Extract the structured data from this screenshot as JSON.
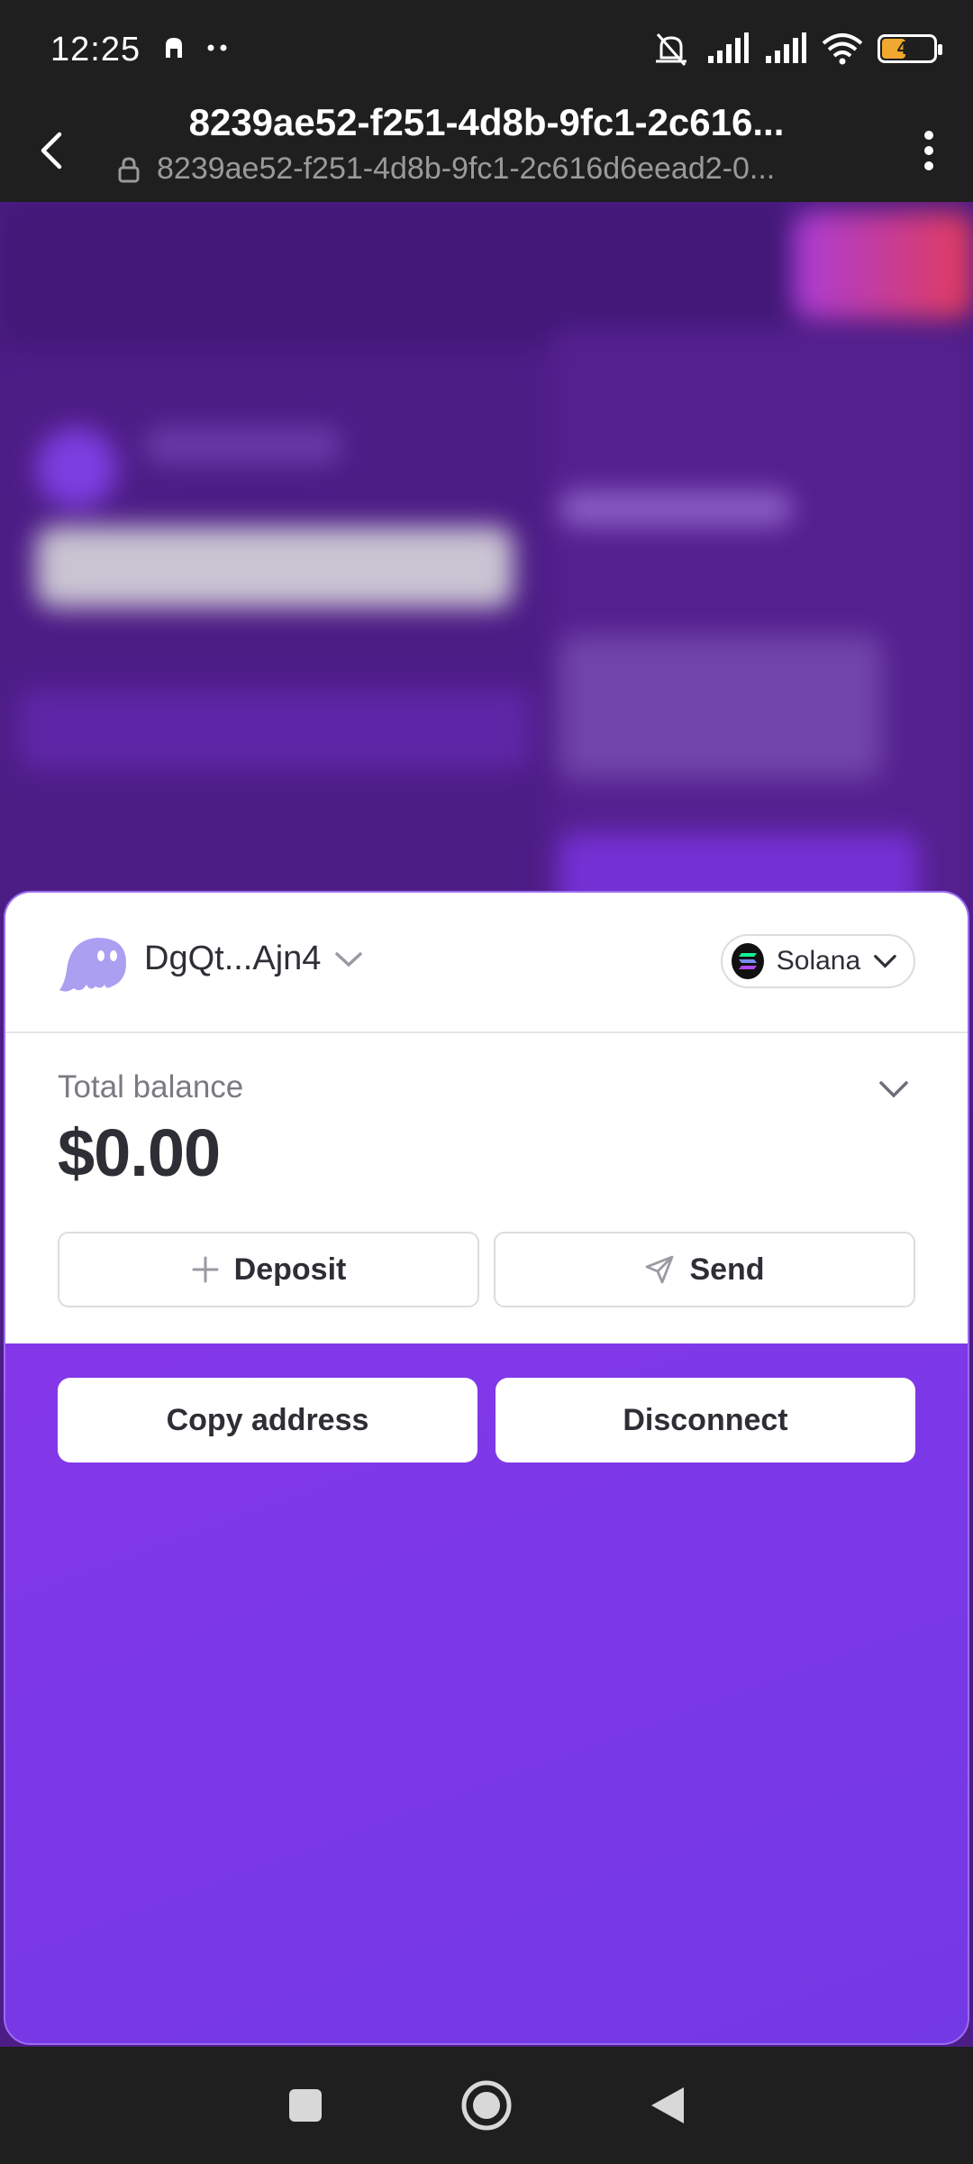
{
  "status_bar": {
    "time": "12:25",
    "battery_level": "43",
    "icons": [
      "notification-icon",
      "more-dots-icon",
      "silent-icon",
      "signal-icon",
      "signal-icon",
      "wifi-icon",
      "battery-icon"
    ]
  },
  "browser": {
    "title": "8239ae52-f251-4d8b-9fc1-2c616...",
    "url": "8239ae52-f251-4d8b-9fc1-2c616d6eead2-0...",
    "icons": [
      "back-arrow-icon",
      "lock-icon",
      "more-vertical-icon"
    ]
  },
  "wallet": {
    "account_name": "DgQt...Ajn4",
    "network": "Solana",
    "balance_label": "Total balance",
    "balance_value": "$0.00",
    "deposit_label": "Deposit",
    "send_label": "Send",
    "copy_address_label": "Copy address",
    "disconnect_label": "Disconnect",
    "colors": {
      "accent": "#8d36ea",
      "text": "#2e2e36",
      "muted": "#7a7a84",
      "ghost": "#ab9ff2"
    }
  },
  "nav": {
    "icons": [
      "recents-icon",
      "home-icon",
      "back-triangle-icon"
    ]
  }
}
